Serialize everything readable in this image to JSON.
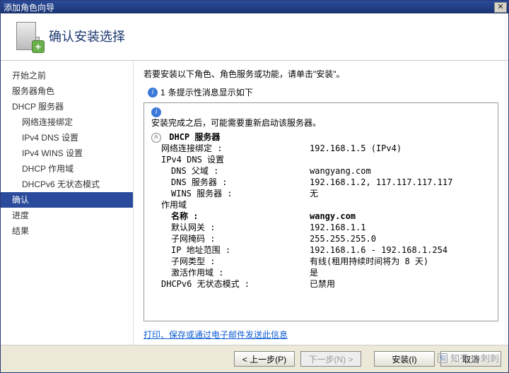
{
  "window": {
    "title": "添加角色向导"
  },
  "header": {
    "title": "确认安装选择"
  },
  "sidebar": {
    "items": [
      {
        "label": "开始之前",
        "level": 0
      },
      {
        "label": "服务器角色",
        "level": 0
      },
      {
        "label": "DHCP 服务器",
        "level": 0
      },
      {
        "label": "网络连接绑定",
        "level": 1
      },
      {
        "label": "IPv4 DNS 设置",
        "level": 1
      },
      {
        "label": "IPv4 WINS 设置",
        "level": 1
      },
      {
        "label": "DHCP 作用域",
        "level": 1
      },
      {
        "label": "DHCPv6 无状态模式",
        "level": 1
      },
      {
        "label": "确认",
        "level": 0,
        "selected": true
      },
      {
        "label": "进度",
        "level": 0
      },
      {
        "label": "结果",
        "level": 0
      }
    ]
  },
  "main": {
    "instruction": "若要安装以下角色、角色服务或功能，请单击\"安装\"。",
    "info_count": "1",
    "info_text": "条提示性消息显示如下",
    "restart_note": "安装完成之后，可能需要重新启动该服务器。",
    "group_title": "DHCP 服务器",
    "rows": {
      "net_bind_label": "网络连接绑定 :",
      "net_bind_value": "192.168.1.5 (IPv4)",
      "ipv4dns_header": "IPv4 DNS 设置",
      "dns_parent_label": "DNS 父域 :",
      "dns_parent_value": "wangyang.com",
      "dns_server_label": "DNS 服务器 :",
      "dns_server_value": "192.168.1.2, 117.117.117.117",
      "wins_server_label": "WINS 服务器 :",
      "wins_server_value": "无",
      "scope_header": "作用域",
      "name_label": "名称 :",
      "name_value": "wangy.com",
      "gateway_label": "默认网关 :",
      "gateway_value": "192.168.1.1",
      "mask_label": "子网掩码 :",
      "mask_value": "255.255.255.0",
      "iprange_label": "IP 地址范围 :",
      "iprange_value": "192.168.1.6 - 192.168.1.254",
      "subtype_label": "子网类型 :",
      "subtype_value": "有线(租用持续时间将为 8 天)",
      "activate_label": "激活作用域 :",
      "activate_value": "是",
      "dhcpv6_label": "DHCPv6 无状态模式 :",
      "dhcpv6_value": "已禁用"
    },
    "link_text": "打印、保存或通过电子邮件发送此信息"
  },
  "footer": {
    "prev": "< 上一步(P)",
    "next": "下一步(N) >",
    "install": "安装(I)",
    "cancel": "取消"
  },
  "watermark": "知乎 @刺刺"
}
